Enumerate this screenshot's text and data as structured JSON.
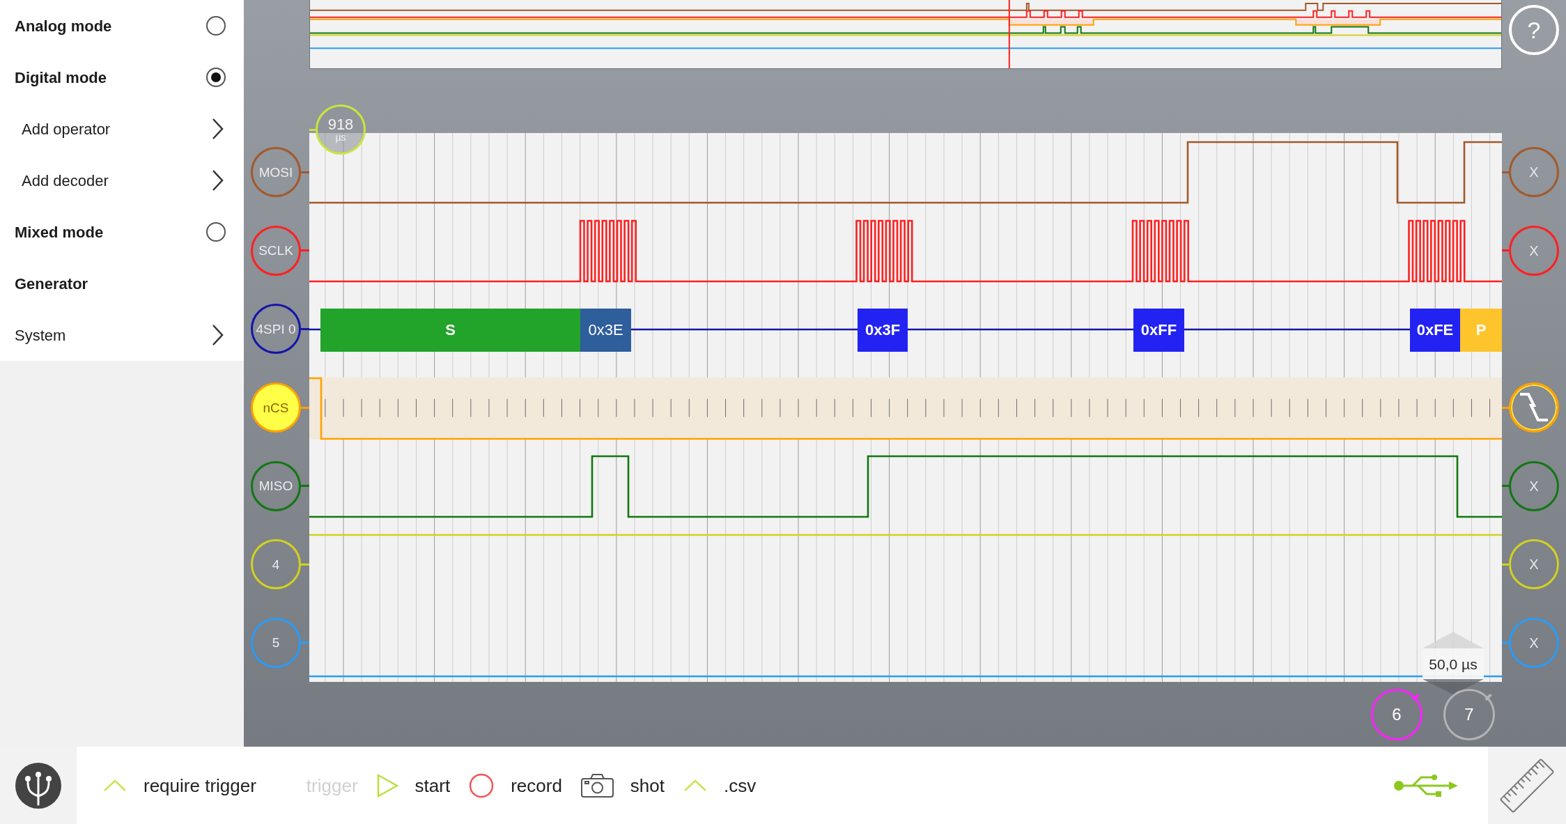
{
  "sidebar": {
    "items": [
      {
        "kind": "radio",
        "label": "Analog mode",
        "selected": false
      },
      {
        "kind": "radio",
        "label": "Digital mode",
        "selected": true,
        "children": [
          {
            "kind": "submenu",
            "label": "Add operator"
          },
          {
            "kind": "submenu",
            "label": "Add decoder"
          }
        ]
      },
      {
        "kind": "radio",
        "label": "Mixed mode",
        "selected": false
      },
      {
        "kind": "section",
        "label": "Generator"
      },
      {
        "kind": "submenu",
        "label": "System"
      }
    ]
  },
  "help_button": {
    "label": "?"
  },
  "cursor": {
    "value": "918",
    "unit": "µs"
  },
  "channels": [
    {
      "kind": "digital",
      "label": "MOSI",
      "color": "#a05a2c",
      "selected": false,
      "trigger": {
        "kind": "any",
        "label": "X"
      }
    },
    {
      "kind": "digital",
      "label": "SCLK",
      "color": "#ff2020",
      "selected": false,
      "trigger": {
        "kind": "any",
        "label": "X"
      }
    },
    {
      "kind": "decoder",
      "label": "4SPI 0",
      "color": "#1414a8",
      "selected": false,
      "packets": [
        {
          "kind": "start",
          "label": "S",
          "selected": false
        },
        {
          "kind": "data",
          "label": "0x3E",
          "selected": true
        },
        {
          "kind": "data",
          "label": "0x3F",
          "selected": false
        },
        {
          "kind": "data",
          "label": "0xFF",
          "selected": false
        },
        {
          "kind": "data",
          "label": "0xFE",
          "selected": false
        },
        {
          "kind": "stop",
          "label": "P",
          "selected": false
        }
      ]
    },
    {
      "kind": "digital",
      "label": "nCS",
      "color": "#ffa200",
      "selected": true,
      "trigger": {
        "kind": "falling"
      }
    },
    {
      "kind": "digital",
      "label": "MISO",
      "color": "#117711",
      "selected": false,
      "trigger": {
        "kind": "any",
        "label": "X"
      }
    },
    {
      "kind": "digital",
      "label": "4",
      "color": "#d2d21e",
      "selected": false,
      "trigger": {
        "kind": "any",
        "label": "X"
      }
    },
    {
      "kind": "digital",
      "label": "5",
      "color": "#2a9bf5",
      "selected": false,
      "trigger": {
        "kind": "any",
        "label": "X"
      }
    }
  ],
  "timescale": {
    "label": "50,0 µs"
  },
  "extra_channels": [
    {
      "label": "6",
      "color": "#ff22ff"
    },
    {
      "label": "7",
      "color": "#b4b4b4"
    }
  ],
  "toolbar": {
    "items": [
      {
        "kind": "expander",
        "label": "require trigger",
        "disabled": false
      },
      {
        "kind": "plain",
        "label": "trigger",
        "disabled": true
      },
      {
        "kind": "play",
        "label": "start",
        "disabled": false
      },
      {
        "kind": "record",
        "label": "record",
        "disabled": false
      },
      {
        "kind": "camera",
        "label": "shot",
        "disabled": false
      },
      {
        "kind": "expander",
        "label": ".csv",
        "disabled": false
      }
    ]
  }
}
